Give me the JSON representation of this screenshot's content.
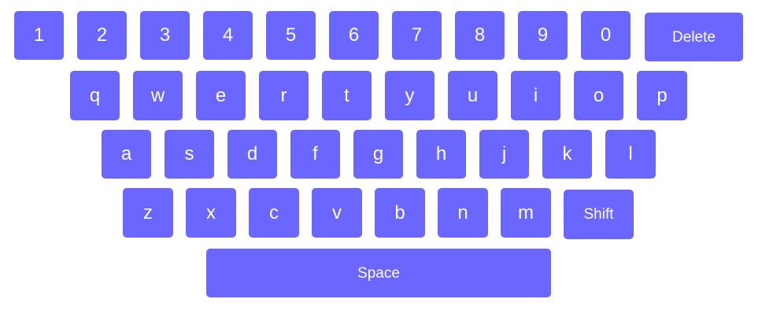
{
  "keyboard": {
    "key_color": "#6a66ff",
    "text_color": "#ffffff",
    "rows": [
      [
        "1",
        "2",
        "3",
        "4",
        "5",
        "6",
        "7",
        "8",
        "9",
        "0",
        "Delete"
      ],
      [
        "q",
        "w",
        "e",
        "r",
        "t",
        "y",
        "u",
        "i",
        "o",
        "p"
      ],
      [
        "a",
        "s",
        "d",
        "f",
        "g",
        "h",
        "j",
        "k",
        "l"
      ],
      [
        "z",
        "x",
        "c",
        "v",
        "b",
        "n",
        "m",
        "Shift"
      ],
      [
        "Space"
      ]
    ]
  }
}
